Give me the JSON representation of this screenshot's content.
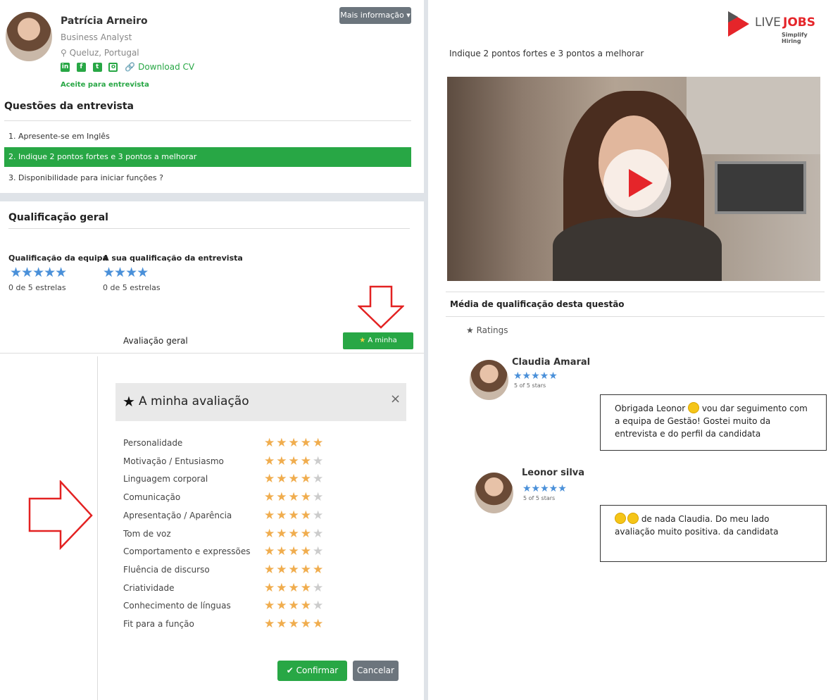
{
  "candidate": {
    "name": "Patrícia Arneiro",
    "role": "Business Analyst",
    "location": "Queluz, Portugal",
    "download_cv": "Download CV",
    "status": "Aceite para entrevista",
    "more_info": "Mais informação ▾"
  },
  "questions": {
    "title": "Questões da entrevista",
    "items": [
      "1. Apresente-se em Inglês",
      "2. Indique 2 pontos fortes e 3 pontos a melhorar",
      "3. Disponibilidade para iniciar funções ?"
    ]
  },
  "qualification": {
    "title": "Qualificação geral",
    "team_label": "Qualificação da equipa",
    "team_stars": "★★★★★",
    "team_value": "0 de 5 estrelas",
    "mine_label": "A sua qualificação da entrevista",
    "mine_stars": "★★★★",
    "mine_value": "0 de 5 estrelas",
    "overall_label": "Avaliação geral",
    "my_eval_button": "A minha avaliação"
  },
  "evaluation": {
    "title": "A minha avaliação",
    "close": "×",
    "criteria": [
      {
        "label": "Personalidade",
        "rating": 5
      },
      {
        "label": "Motivação / Entusiasmo",
        "rating": 4
      },
      {
        "label": "Linguagem corporal",
        "rating": 4
      },
      {
        "label": "Comunicação",
        "rating": 4
      },
      {
        "label": "Apresentação / Aparência",
        "rating": 4
      },
      {
        "label": "Tom de voz",
        "rating": 4
      },
      {
        "label": "Comportamento e expressões",
        "rating": 4
      },
      {
        "label": "Fluência de discurso",
        "rating": 5
      },
      {
        "label": "Criatividade",
        "rating": 4
      },
      {
        "label": "Conhecimento de línguas",
        "rating": 4
      },
      {
        "label": "Fit para a função",
        "rating": 5
      }
    ],
    "confirm": "Confirmar",
    "cancel": "Cancelar"
  },
  "right": {
    "logo_live": "LIVE",
    "logo_jobs": "JOBS",
    "logo_tagline": "Simplify Hiring",
    "question": "Indique 2 pontos fortes e 3 pontos a melhorar",
    "avg_title": "Média de qualificação desta questão",
    "ratings_label": "Ratings",
    "reviewers": [
      {
        "name": "Claudia Amaral",
        "stars": "★★★★★",
        "sub": "5 of 5 stars"
      },
      {
        "name": "Leonor silva",
        "stars": "★★★★★",
        "sub": "5 of 5 stars"
      }
    ],
    "comments": [
      {
        "before": "Obrigada Leonor",
        "after": " vou dar seguimento com a equipa de Gestão! Gostei muito da entrevista e do perfil da candidata"
      },
      {
        "before": "",
        "after": " de nada Claudia. Do meu lado avaliação muito positiva. da candidata"
      }
    ]
  },
  "colors": {
    "accent_green": "#28a745",
    "star_blue": "#4a90d9",
    "star_gold": "#f0ad4e",
    "brand_red": "#e5252a"
  }
}
